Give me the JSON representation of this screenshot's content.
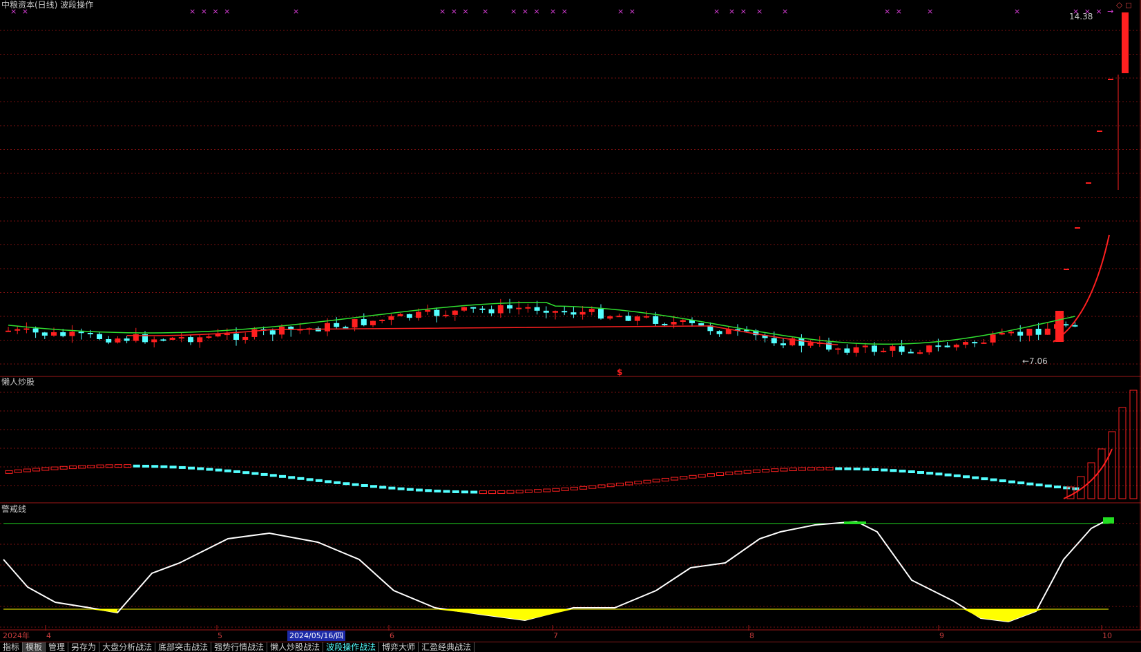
{
  "panels": {
    "main_title": "中粮资本(日线) 波段操作",
    "sub1_title": "懒人炒股",
    "sub2_title": "警戒线"
  },
  "price_labels": {
    "high": "14.38",
    "low": "←7.06",
    "signal": "$"
  },
  "top_right_icons": "◇ ◻",
  "x_markers": [
    "× ×",
    "× × × ×",
    "×",
    "× × ×",
    "×",
    "× × ×",
    "× ×",
    "× ×",
    "×",
    "× ×",
    "×",
    "×",
    "× ×",
    "×",
    "×",
    "× × × →"
  ],
  "date_axis": {
    "year": "2024年",
    "months": [
      "4",
      "5",
      "6",
      "7",
      "8",
      "9",
      "10"
    ],
    "cursor_date": "2024/05/16/四"
  },
  "tabs": [
    {
      "label": "指标"
    },
    {
      "label": "模板"
    },
    {
      "label": "管理"
    },
    {
      "label": "另存为"
    },
    {
      "label": "大盘分析战法"
    },
    {
      "label": "底部突击战法"
    },
    {
      "label": "强势行情战法"
    },
    {
      "label": "懒人炒股战法"
    },
    {
      "label": "波段操作战法"
    },
    {
      "label": "博弈大师"
    },
    {
      "label": "汇盈经典战法"
    }
  ],
  "colors": {
    "up": "#ff2020",
    "down": "#54ffff",
    "ma_green": "#30e030",
    "ma_red": "#ff2020",
    "white_line": "#ffffff",
    "warning_green": "#22dd22",
    "warning_yellow": "#ffff00",
    "grid": "#7a1010"
  }
}
